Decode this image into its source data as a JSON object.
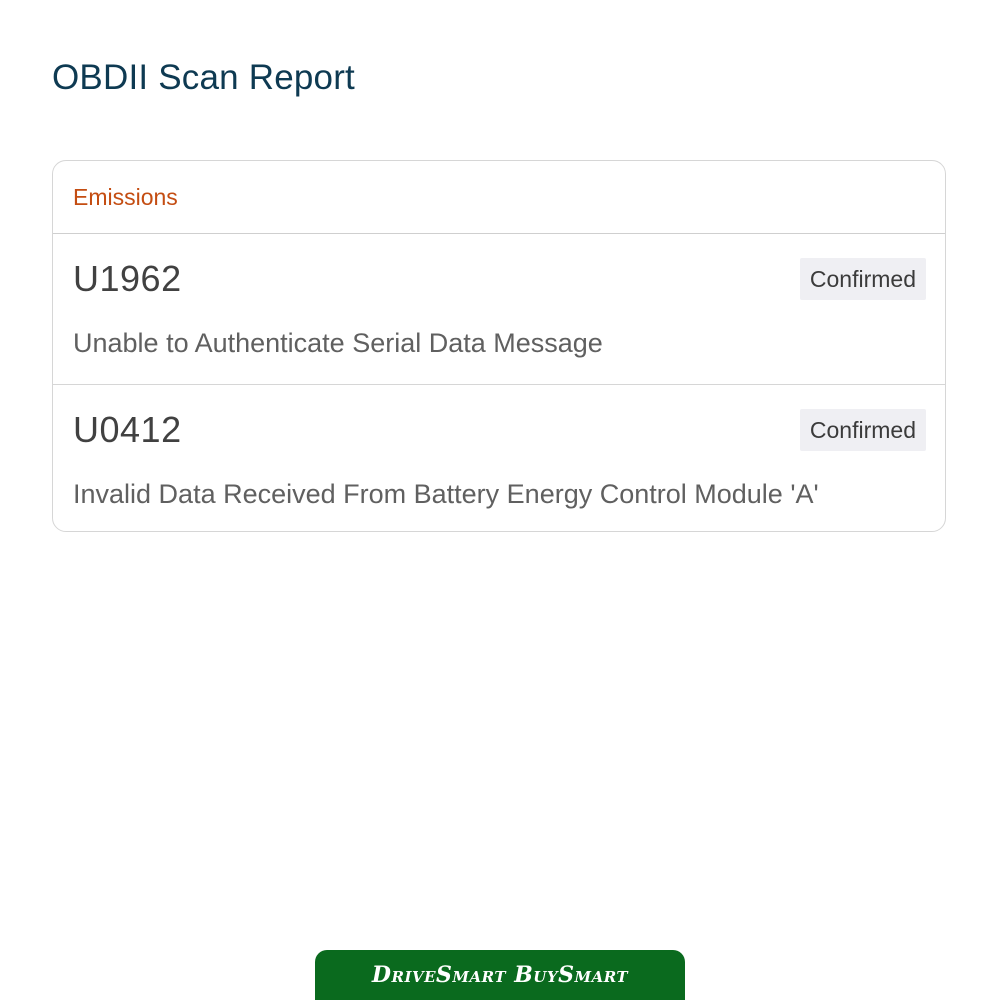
{
  "header": {
    "title": "OBDII Scan Report"
  },
  "report": {
    "section_label": "Emissions",
    "codes": [
      {
        "code": "U1962",
        "status": "Confirmed",
        "description": "Unable to Authenticate Serial Data Message"
      },
      {
        "code": "U0412",
        "status": "Confirmed",
        "description": "Invalid Data Received From Battery Energy Control Module 'A'"
      }
    ]
  },
  "footer": {
    "brand_logo": "DriveSmart BuySmart",
    "brand_color": "#0a6a1e"
  },
  "colors": {
    "title": "#0e3a52",
    "section_label": "#c44d12",
    "badge_bg": "#efeff3"
  }
}
